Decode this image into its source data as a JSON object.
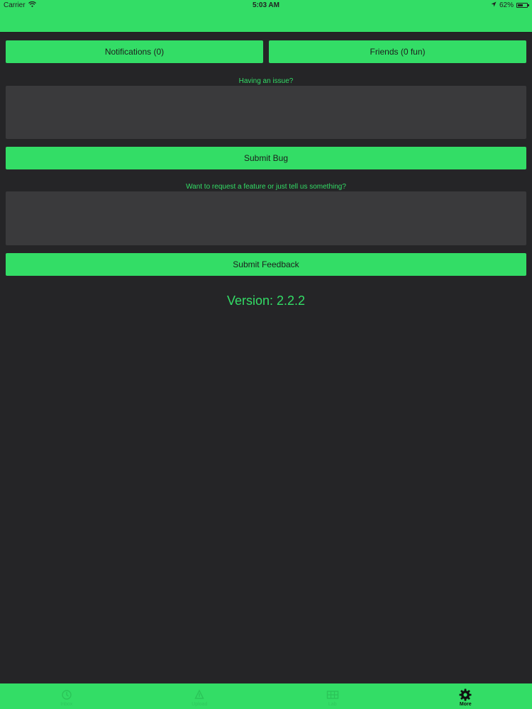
{
  "status": {
    "carrier": "Carrier",
    "time": "5:03 AM",
    "battery": "62%",
    "battery_level": 0.62
  },
  "header_buttons": {
    "notifications": "Notifications (0)",
    "friends": "Friends (0 fun)"
  },
  "bug": {
    "prompt": "Having an issue?",
    "value": "",
    "submit": "Submit Bug"
  },
  "feedback": {
    "prompt": "Want to request a feature or just tell us something?",
    "value": "",
    "submit": "Submit Feedback"
  },
  "version": "Version: 2.2.2",
  "tabs": [
    {
      "label": "Inbox",
      "icon": "inbox-icon"
    },
    {
      "label": "Upload",
      "icon": "upload-icon"
    },
    {
      "label": "Lab",
      "icon": "lab-icon"
    },
    {
      "label": "More",
      "icon": "gear-icon"
    }
  ],
  "colors": {
    "accent": "#33dd66",
    "background": "#252527",
    "field": "#3a3a3c"
  }
}
